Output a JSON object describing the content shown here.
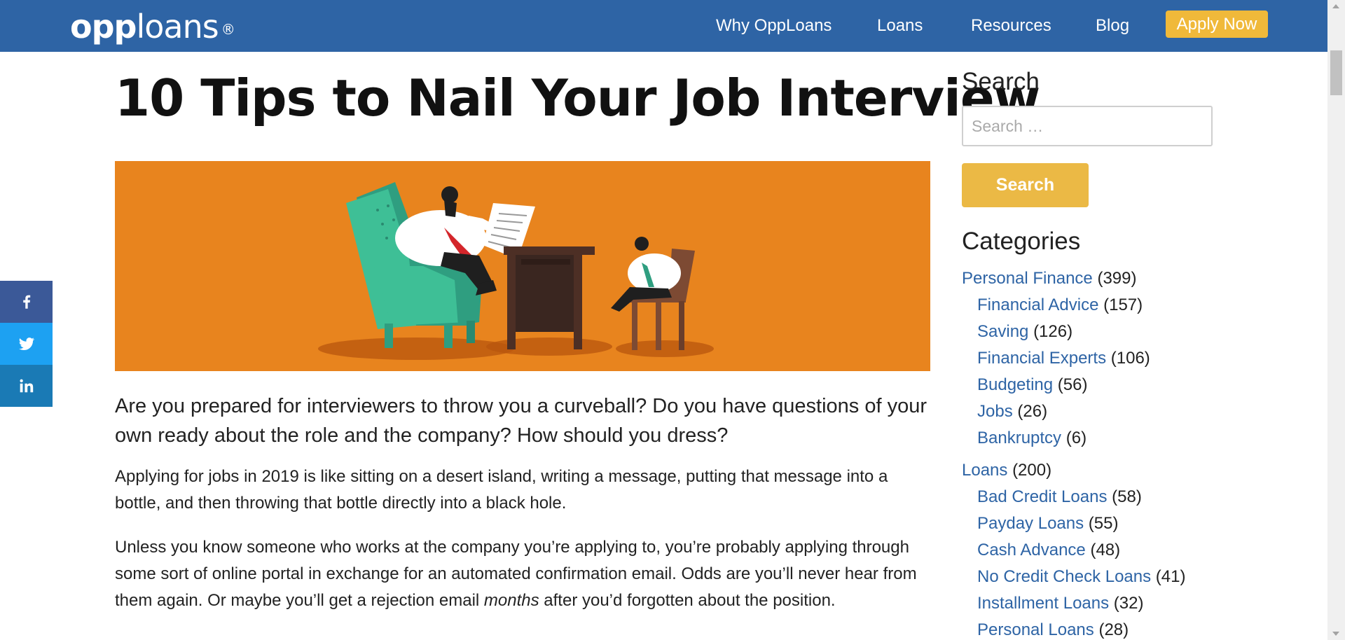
{
  "header": {
    "logo_opp": "opp",
    "logo_loans": "loans",
    "logo_reg": "®",
    "nav": [
      "Why OppLoans",
      "Loans",
      "Resources",
      "Blog"
    ],
    "apply_label": "Apply Now"
  },
  "article": {
    "title": "10 Tips to Nail Your Job Interview",
    "intro": "Are you prepared for interviewers to throw you a curveball? Do you have questions of your own ready about the role and the company? How should you dress?",
    "p1": "Applying for jobs in 2019 is like sitting on a desert island, writing a message, putting that message into a bottle, and then throwing that bottle directly into a black hole.",
    "p2_before": "Unless you know someone who works at the company you’re applying to, you’re probably applying through some sort of online portal in exchange for an automated confirmation email. Odds are you’ll never hear from them again. Or maybe you’ll get a rejection email ",
    "p2_em": "months",
    "p2_after": " after you’d forgotten about the position."
  },
  "sidebar": {
    "search_heading": "Search",
    "search_placeholder": "Search …",
    "search_button": "Search",
    "categories_heading": "Categories",
    "categories": [
      {
        "name": "Personal Finance",
        "count": "(399)"
      },
      {
        "name": "Financial Advice",
        "count": "(157)"
      },
      {
        "name": "Saving",
        "count": "(126)"
      },
      {
        "name": "Financial Experts",
        "count": "(106)"
      },
      {
        "name": "Budgeting",
        "count": "(56)"
      },
      {
        "name": "Jobs",
        "count": "(26)"
      },
      {
        "name": "Bankruptcy",
        "count": "(6)"
      },
      {
        "name": "Loans",
        "count": "(200)"
      },
      {
        "name": "Bad Credit Loans",
        "count": "(58)"
      },
      {
        "name": "Payday Loans",
        "count": "(55)"
      },
      {
        "name": "Cash Advance",
        "count": "(48)"
      },
      {
        "name": "No Credit Check Loans",
        "count": "(41)"
      },
      {
        "name": "Installment Loans",
        "count": "(32)"
      },
      {
        "name": "Personal Loans",
        "count": "(28)"
      }
    ]
  },
  "social": {
    "icons": [
      "facebook-icon",
      "twitter-icon",
      "linkedin-icon"
    ]
  },
  "colors": {
    "header_bg": "#2e64a5",
    "accent_yellow": "#f0b93a",
    "hero_bg": "#e8841e",
    "link": "#2e64a5"
  }
}
